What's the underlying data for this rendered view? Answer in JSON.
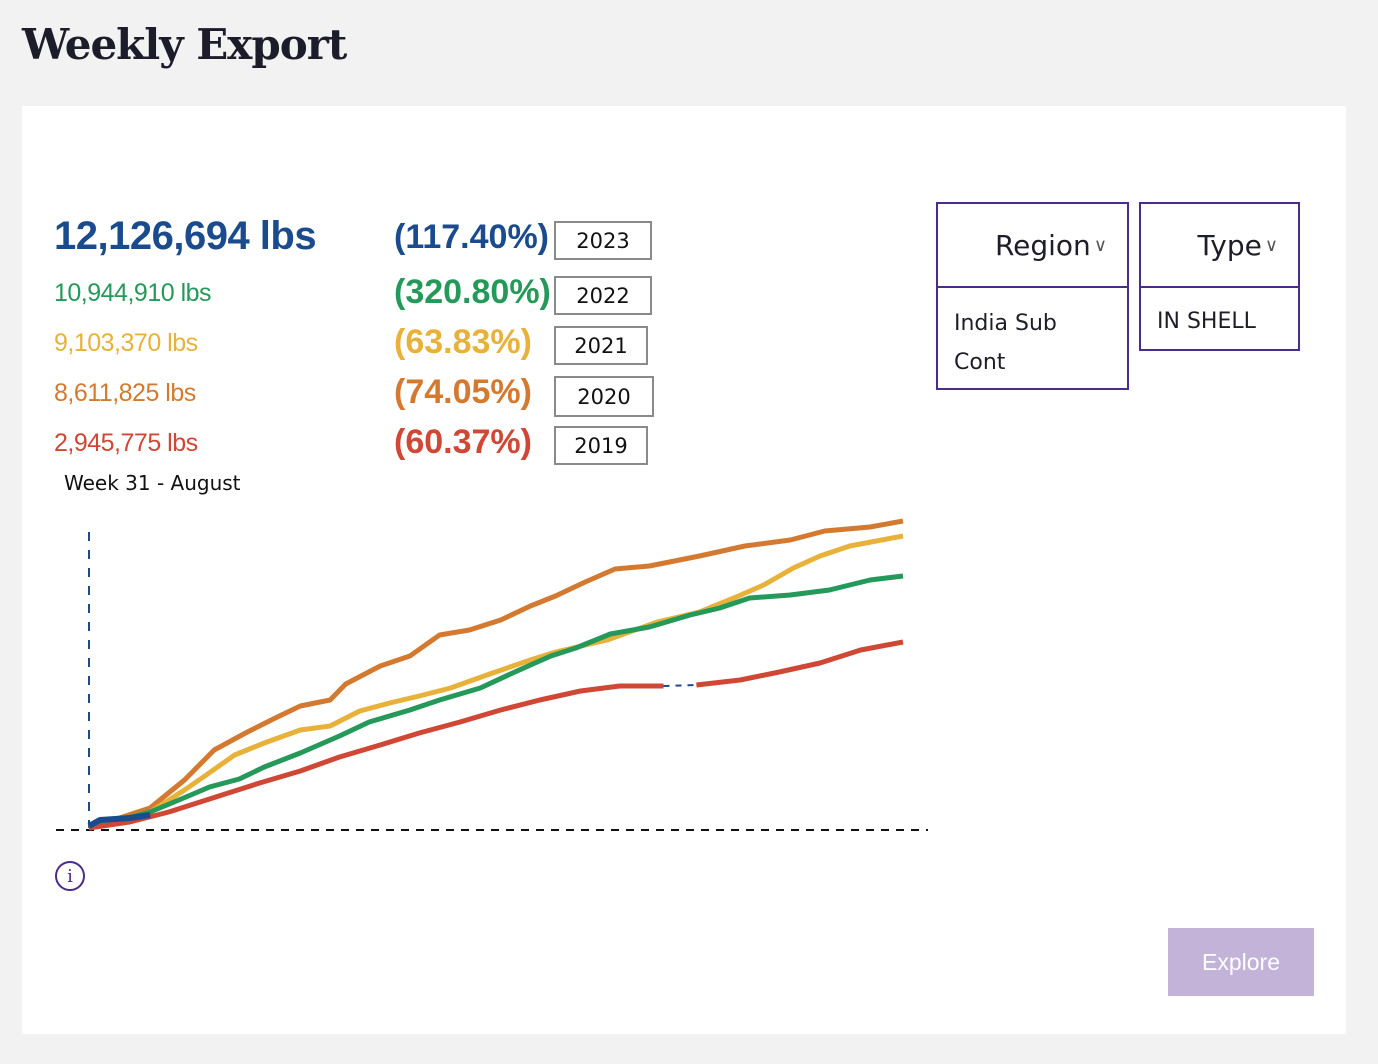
{
  "page": {
    "title": "Weekly Export"
  },
  "summary": [
    {
      "year": "2023",
      "amount": "12,126,694 lbs",
      "percent": "(117.40%)",
      "color": "#1a4b8c"
    },
    {
      "year": "2022",
      "amount": "10,944,910 lbs",
      "percent": "(320.80%)",
      "color": "#24995a"
    },
    {
      "year": "2021",
      "amount": "9,103,370 lbs",
      "percent": "(63.83%)",
      "color": "#e8b23a"
    },
    {
      "year": "2020",
      "amount": "8,611,825 lbs",
      "percent": "(74.05%)",
      "color": "#d47a30"
    },
    {
      "year": "2019",
      "amount": "2,945,775 lbs",
      "percent": "(60.37%)",
      "color": "#d04735"
    }
  ],
  "week_label": "Week 31 - August",
  "filters": {
    "region": {
      "label": "Region",
      "value": "India Sub Cont"
    },
    "type": {
      "label": "Type",
      "value": "IN SHELL"
    }
  },
  "explore_label": "Explore",
  "info_icon": "info-circle-icon",
  "chart_data": {
    "type": "line",
    "title": "",
    "xlabel": "",
    "ylabel": "",
    "grid": false,
    "xlim": [
      0,
      52
    ],
    "ylim": [
      0,
      310
    ],
    "series": [
      {
        "name": "2020",
        "color": "#d47a30",
        "points": [
          [
            0,
            0
          ],
          [
            3.9,
            20
          ],
          [
            6.1,
            48
          ],
          [
            8.0,
            78
          ],
          [
            10.0,
            95
          ],
          [
            11.9,
            110
          ],
          [
            13.5,
            122
          ],
          [
            15.4,
            128
          ],
          [
            16.4,
            144
          ],
          [
            18.6,
            162
          ],
          [
            20.5,
            172
          ],
          [
            22.4,
            193
          ],
          [
            24.3,
            198
          ],
          [
            26.3,
            208
          ],
          [
            28.2,
            222
          ],
          [
            29.8,
            232
          ],
          [
            31.7,
            246
          ],
          [
            33.6,
            259
          ],
          [
            35.8,
            262
          ],
          [
            39.0,
            272
          ],
          [
            41.9,
            282
          ],
          [
            44.8,
            288
          ],
          [
            47.0,
            297
          ],
          [
            49.9,
            301
          ],
          [
            52,
            307
          ]
        ]
      },
      {
        "name": "2021",
        "color": "#e8b23a",
        "points": [
          [
            0,
            0
          ],
          [
            3.9,
            16
          ],
          [
            6.1,
            38
          ],
          [
            7.4,
            52
          ],
          [
            9.3,
            73
          ],
          [
            11.2,
            85
          ],
          [
            13.5,
            98
          ],
          [
            15.4,
            102
          ],
          [
            17.3,
            117
          ],
          [
            19.2,
            125
          ],
          [
            21.1,
            132
          ],
          [
            23.1,
            140
          ],
          [
            25.6,
            154
          ],
          [
            28.2,
            168
          ],
          [
            29.8,
            176
          ],
          [
            33.1,
            188
          ],
          [
            36.3,
            206
          ],
          [
            39.0,
            216
          ],
          [
            41.2,
            230
          ],
          [
            43.1,
            243
          ],
          [
            45.0,
            260
          ],
          [
            46.7,
            272
          ],
          [
            48.6,
            282
          ],
          [
            52,
            292
          ]
        ]
      },
      {
        "name": "2022",
        "color": "#24995a",
        "points": [
          [
            0,
            0
          ],
          [
            3.9,
            16
          ],
          [
            6.5,
            33
          ],
          [
            7.7,
            41
          ],
          [
            9.6,
            49
          ],
          [
            11.2,
            61
          ],
          [
            13.5,
            75
          ],
          [
            16.0,
            92
          ],
          [
            17.9,
            106
          ],
          [
            20.5,
            118
          ],
          [
            22.4,
            128
          ],
          [
            25.0,
            140
          ],
          [
            27.2,
            156
          ],
          [
            29.5,
            172
          ],
          [
            31.1,
            180
          ],
          [
            33.3,
            194
          ],
          [
            35.8,
            201
          ],
          [
            38.4,
            213
          ],
          [
            40.3,
            220
          ],
          [
            42.2,
            230
          ],
          [
            44.8,
            233
          ],
          [
            47.3,
            238
          ],
          [
            49.9,
            248
          ],
          [
            52,
            252
          ]
        ]
      },
      {
        "name": "2019",
        "color": "#d04735",
        "points": [
          [
            0,
            0
          ],
          [
            2.6,
            6
          ],
          [
            5.1,
            16
          ],
          [
            8.3,
            32
          ],
          [
            10.9,
            45
          ],
          [
            13.5,
            57
          ],
          [
            16.0,
            71
          ],
          [
            18.6,
            83
          ],
          [
            21.1,
            95
          ],
          [
            23.7,
            106
          ],
          [
            26.3,
            118
          ],
          [
            28.8,
            128
          ],
          [
            31.4,
            137
          ],
          [
            33.9,
            142
          ],
          [
            36.7,
            142
          ]
        ],
        "points_after_gap": [
          [
            38.8,
            143
          ],
          [
            41.6,
            148
          ],
          [
            44.1,
            156
          ],
          [
            46.7,
            165
          ],
          [
            49.3,
            178
          ],
          [
            52,
            186
          ]
        ]
      },
      {
        "name": "2023",
        "color": "#1a4b8c",
        "points": [
          [
            0,
            2
          ],
          [
            0.7,
            8
          ],
          [
            2.6,
            10
          ],
          [
            3.9,
            13
          ]
        ]
      }
    ]
  }
}
